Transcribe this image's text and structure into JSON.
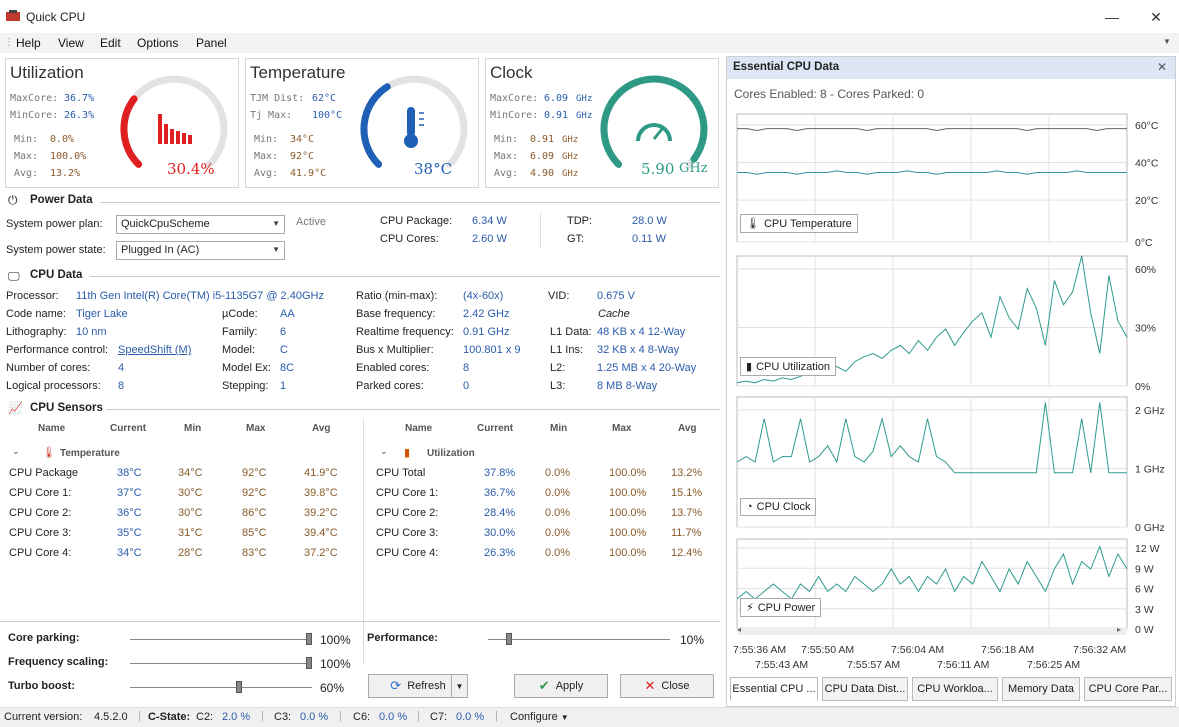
{
  "app": {
    "title": "Quick CPU"
  },
  "menu": [
    "Help",
    "View",
    "Edit",
    "Options",
    "Panel"
  ],
  "gauges": {
    "utilization": {
      "title": "Utilization",
      "rows": [
        [
          "MaxCore:",
          "36.7%"
        ],
        [
          "MinCore:",
          "26.3%"
        ],
        [
          "Min:",
          "0.0%"
        ],
        [
          "Max:",
          "100.0%"
        ],
        [
          "Avg:",
          "13.2%"
        ]
      ],
      "value": "30.4%",
      "fraction": 0.304,
      "color": "#e02020"
    },
    "temperature": {
      "title": "Temperature",
      "rows": [
        [
          "TJM Dist:",
          "62°C"
        ],
        [
          "Tj Max:",
          "100°C"
        ],
        [
          "Min:",
          "34°C"
        ],
        [
          "Max:",
          "92°C"
        ],
        [
          "Avg:",
          "41.9°C"
        ]
      ],
      "value": "38°C",
      "fraction": 0.38,
      "color": "#1f5fb5"
    },
    "clock": {
      "title": "Clock",
      "rows": [
        [
          "MaxCore:",
          "6.09",
          "GHz"
        ],
        [
          "MinCore:",
          "0.91",
          "GHz"
        ],
        [
          "Min:",
          "0.91",
          "GHz"
        ],
        [
          "Max:",
          "6.09",
          "GHz"
        ],
        [
          "Avg:",
          "4.90",
          "GHz"
        ]
      ],
      "value": "5.90",
      "unit": "GHz",
      "fraction": 0.97,
      "color": "#2e9a86"
    }
  },
  "power": {
    "section": "Power Data",
    "plan_label": "System power plan:",
    "plan_value": "QuickCpuScheme",
    "plan_status": "Active",
    "state_label": "System power state:",
    "state_value": "Plugged In (AC)",
    "pkg_label": "CPU Package:",
    "pkg_value": "6.34 W",
    "cores_label": "CPU Cores:",
    "cores_value": "2.60 W",
    "tdp_label": "TDP:",
    "tdp_value": "28.0 W",
    "gt_label": "GT:",
    "gt_value": "0.11 W"
  },
  "cpu": {
    "section": "CPU Data",
    "processor_label": "Processor:",
    "processor": "11th Gen Intel(R) Core(TM) i5-1135G7 @ 2.40GHz",
    "codename_label": "Code name:",
    "codename": "Tiger Lake",
    "litho_label": "Lithography:",
    "litho": "10 nm",
    "perf_label": "Performance control:",
    "perf": "SpeedShift (M)",
    "ncores_label": "Number of cores:",
    "ncores": "4",
    "lproc_label": "Logical processors:",
    "lproc": "8",
    "ucode_label": "µCode:",
    "ucode": "AA",
    "family_label": "Family:",
    "family": "6",
    "model_label": "Model:",
    "model": "C",
    "modelex_label": "Model Ex:",
    "modelex": "8C",
    "stepping_label": "Stepping:",
    "stepping": "1",
    "ratio_label": "Ratio (min-max):",
    "ratio": "(4x-60x)",
    "basefreq_label": "Base frequency:",
    "basefreq": "2.42 GHz",
    "rtfreq_label": "Realtime frequency:",
    "rtfreq": "0.91 GHz",
    "busmul_label": "Bus x Multiplier:",
    "busmul": "100.801 x 9",
    "enabled_label": "Enabled cores:",
    "enabled": "8",
    "parked_label": "Parked cores:",
    "parked": "0",
    "vid_label": "VID:",
    "vid": "0.675 V",
    "cache_label": "Cache",
    "l1d_label": "L1 Data:",
    "l1d": "48 KB x 4  12-Way",
    "l1i_label": "L1 Ins:",
    "l1i": "32 KB x 4  8-Way",
    "l2_label": "L2:",
    "l2": "1.25 MB x 4  20-Way",
    "l3_label": "L3:",
    "l3": "8 MB  8-Way"
  },
  "sensors": {
    "section": "CPU Sensors",
    "headers": [
      "Name",
      "Current",
      "Min",
      "Max",
      "Avg"
    ],
    "temp_group": "Temperature",
    "temp_rows": [
      [
        "CPU Package",
        "38°C",
        "34°C",
        "92°C",
        "41.9°C"
      ],
      [
        "CPU Core 1:",
        "37°C",
        "30°C",
        "92°C",
        "39.8°C"
      ],
      [
        "CPU Core 2:",
        "36°C",
        "30°C",
        "86°C",
        "39.2°C"
      ],
      [
        "CPU Core 3:",
        "35°C",
        "31°C",
        "85°C",
        "39.4°C"
      ],
      [
        "CPU Core 4:",
        "34°C",
        "28°C",
        "83°C",
        "37.2°C"
      ]
    ],
    "util_group": "Utilization",
    "util_rows": [
      [
        "CPU Total",
        "37.8%",
        "0.0%",
        "100.0%",
        "13.2%"
      ],
      [
        "CPU Core 1:",
        "36.7%",
        "0.0%",
        "100.0%",
        "15.1%"
      ],
      [
        "CPU Core 2:",
        "28.4%",
        "0.0%",
        "100.0%",
        "13.7%"
      ],
      [
        "CPU Core 3:",
        "30.0%",
        "0.0%",
        "100.0%",
        "11.7%"
      ],
      [
        "CPU Core 4:",
        "26.3%",
        "0.0%",
        "100.0%",
        "12.4%"
      ]
    ]
  },
  "controls": {
    "core_parking_label": "Core parking:",
    "core_parking": "100%",
    "core_parking_level": 1.0,
    "freq_scaling_label": "Frequency scaling:",
    "freq_scaling": "100%",
    "freq_scaling_level": 1.0,
    "turbo_label": "Turbo boost:",
    "turbo": "60%",
    "turbo_level": 0.6,
    "performance_label": "Performance:",
    "performance": "10%",
    "performance_level": 0.1,
    "refresh": "Refresh",
    "apply": "Apply",
    "close": "Close"
  },
  "status": {
    "version_label": "Current version:",
    "version": "4.5.2.0",
    "cstate_label": "C-State:",
    "c2_label": "C2:",
    "c2": "2.0 %",
    "c3_label": "C3:",
    "c3": "0.0 %",
    "c6_label": "C6:",
    "c6": "0.0 %",
    "c7_label": "C7:",
    "c7": "0.0 %",
    "configure": "Configure"
  },
  "essential": {
    "title": "Essential CPU Data",
    "summary": "Cores Enabled: 8 - Cores Parked: 0",
    "tabs": [
      "Essential CPU ...",
      "CPU Data Dist...",
      "CPU Workloa...",
      "Memory Data",
      "CPU Core Par..."
    ]
  },
  "chart_data": [
    {
      "type": "line",
      "title": "CPU Temperature",
      "y_ticks": [
        "60°C",
        "40°C",
        "20°C",
        "0°C"
      ],
      "ylim": [
        0,
        70
      ],
      "series": [
        {
          "values": [
            62,
            62,
            61,
            62,
            62,
            62,
            61,
            62,
            62,
            62,
            62,
            62,
            62,
            61,
            62,
            62,
            62,
            62,
            62,
            62,
            61,
            62,
            62,
            62,
            62,
            62,
            62,
            62,
            62,
            61,
            62,
            62,
            62,
            62,
            62,
            62,
            61,
            62,
            62,
            62
          ],
          "color": "#666666"
        },
        {
          "values": [
            38,
            38,
            37,
            38,
            38,
            38,
            37,
            38,
            38,
            38,
            39,
            38,
            38,
            37,
            38,
            38,
            38,
            39,
            38,
            38,
            37,
            38,
            38,
            38,
            38,
            38,
            39,
            38,
            38,
            37,
            38,
            38,
            38,
            38,
            39,
            38,
            38,
            38,
            38,
            38
          ],
          "color": "#2e8fa6"
        }
      ]
    },
    {
      "type": "line",
      "title": "CPU Utilization",
      "y_ticks": [
        "60%",
        "30%",
        "0%"
      ],
      "ylim": [
        0,
        80
      ],
      "series": [
        {
          "values": [
            2,
            3,
            2,
            4,
            3,
            5,
            4,
            6,
            8,
            7,
            10,
            12,
            9,
            15,
            18,
            20,
            17,
            22,
            25,
            20,
            28,
            22,
            30,
            35,
            25,
            33,
            40,
            45,
            30,
            55,
            42,
            35,
            60,
            48,
            25,
            65,
            50,
            58,
            80,
            45,
            20,
            68,
            40,
            30
          ],
          "color": "#2e9a8e"
        }
      ]
    },
    {
      "type": "line",
      "title": "CPU Clock",
      "y_ticks": [
        "2 GHz",
        "1 GHz",
        "0 GHz"
      ],
      "ylim": [
        0,
        2.4
      ],
      "series": [
        {
          "values": [
            1.2,
            1.3,
            1.2,
            2.0,
            1.2,
            1.3,
            1.3,
            2.0,
            1.2,
            1.3,
            1.5,
            1.2,
            2.0,
            1.3,
            1.2,
            1.4,
            2.0,
            1.3,
            1.5,
            1.3,
            1.2,
            2.0,
            1.3,
            1.2,
            1.0,
            1.0,
            1.0,
            1.0,
            1.0,
            1.0,
            1.0,
            1.0,
            1.0,
            1.0,
            2.3,
            1.0,
            1.0,
            1.0,
            2.0,
            1.0,
            2.3,
            1.0,
            1.0,
            1.0
          ],
          "color": "#2e9a8e"
        }
      ]
    },
    {
      "type": "line",
      "title": "CPU Power",
      "y_ticks": [
        "12 W",
        "9 W",
        "6 W",
        "3 W",
        "0 W"
      ],
      "ylim": [
        0,
        12
      ],
      "series": [
        {
          "values": [
            4,
            5,
            4,
            5,
            6,
            5,
            4,
            6,
            5,
            7,
            5,
            6,
            5,
            7,
            6,
            5,
            6,
            8,
            6,
            7,
            5,
            7,
            6,
            8,
            5,
            7,
            6,
            9,
            7,
            5,
            8,
            6,
            9,
            7,
            5,
            8,
            10,
            6,
            9,
            8,
            11,
            7,
            10,
            8
          ],
          "color": "#2e9a8e"
        }
      ]
    }
  ],
  "time_axis": {
    "top": [
      "7:55:36 AM",
      "7:55:50 AM",
      "7:56:04 AM",
      "7:56:18 AM",
      "7:56:32 AM"
    ],
    "bottom": [
      "7:55:43 AM",
      "7:55:57 AM",
      "7:56:11 AM",
      "7:56:25 AM"
    ]
  }
}
